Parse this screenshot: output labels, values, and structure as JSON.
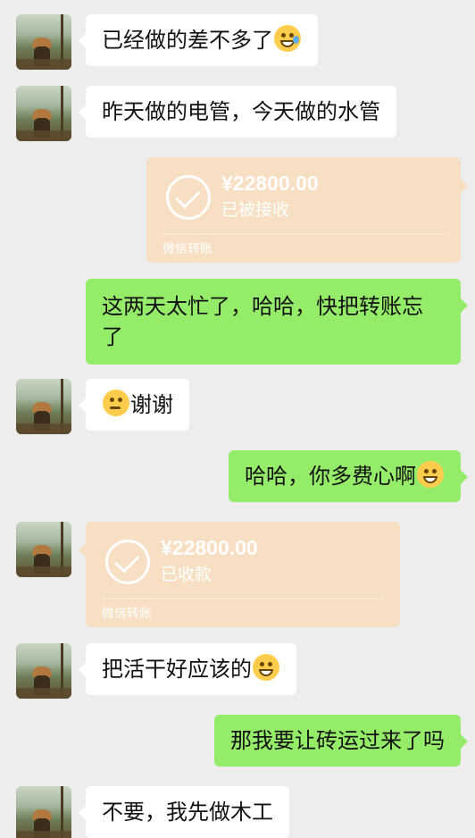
{
  "messages": [
    {
      "text": "已经做的差不多了",
      "emoji": "grinning-sweat-emoji"
    },
    {
      "text": "昨天做的电管，今天做的水管"
    },
    {
      "transfer": {
        "amount": "¥22800.00",
        "status": "已被接收",
        "footer": "微信转账"
      }
    },
    {
      "text_line1": "这两天太忙了，哈哈，快把转账忘",
      "text_line2": "了"
    },
    {
      "text": "谢谢",
      "emoji": "thinking-emoji"
    },
    {
      "text": "哈哈，你多费心啊",
      "emoji": "grinning-emoji"
    },
    {
      "transfer": {
        "amount": "¥22800.00",
        "status": "已收款",
        "footer": "微信转账"
      }
    },
    {
      "text": "把活干好应该的",
      "emoji": "grinning-emoji"
    },
    {
      "text": "那我要让砖运过来了吗"
    },
    {
      "text": "不要，我先做木工"
    }
  ],
  "colors": {
    "background": "#ededed",
    "incoming_bubble": "#ffffff",
    "outgoing_bubble": "#95ec69",
    "transfer_card": "#f7dfc3"
  }
}
